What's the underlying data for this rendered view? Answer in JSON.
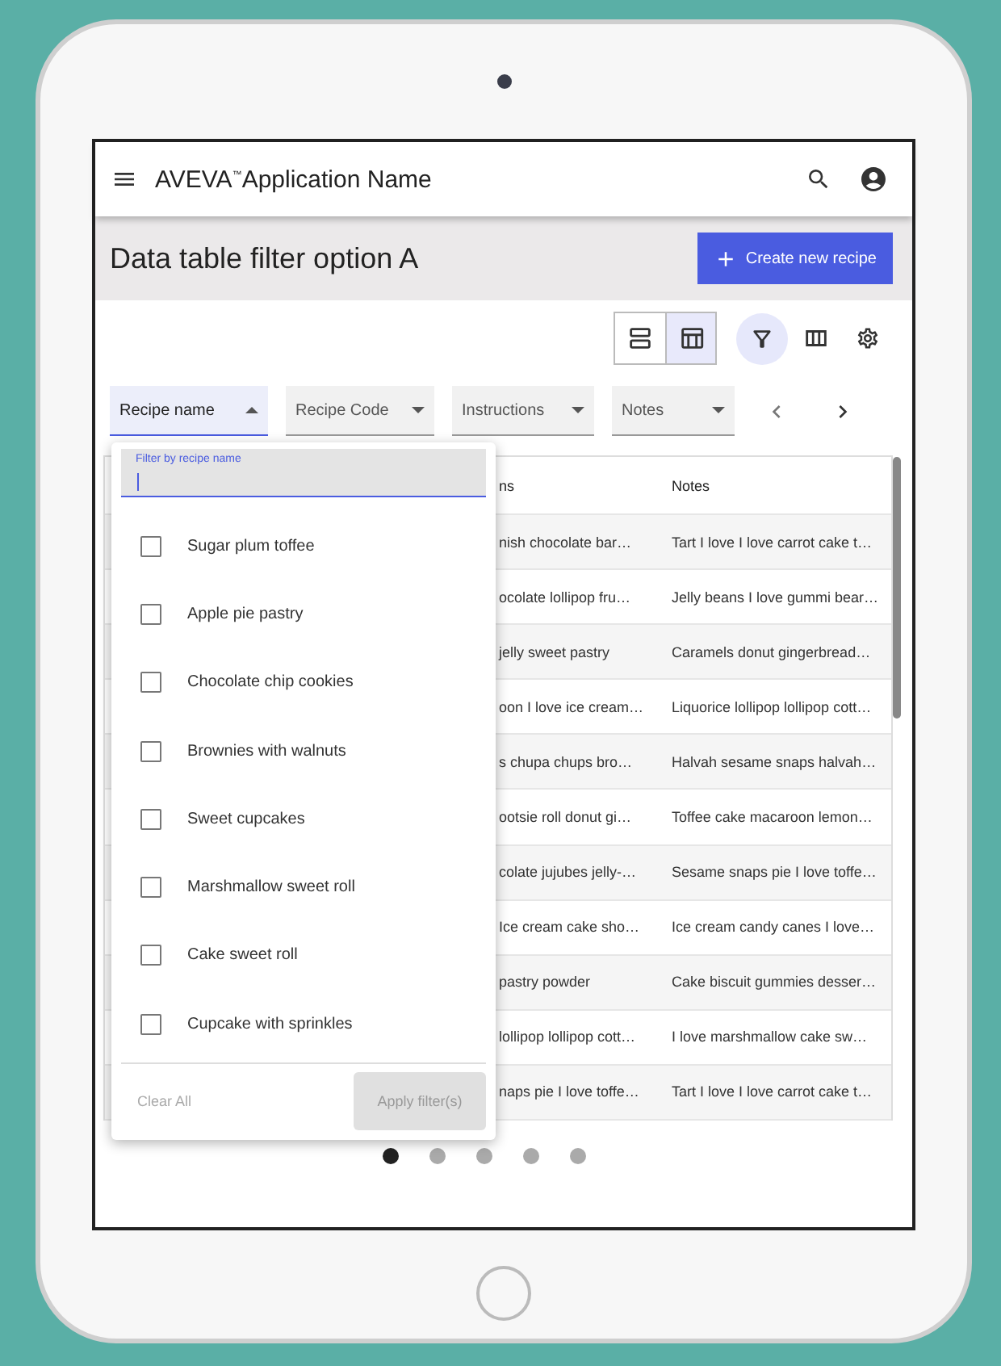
{
  "app_bar": {
    "title": "AVEVA$^{™}$Application Name"
  },
  "page_header": {
    "title": "Data table filter option A",
    "create_button": "Create new recipe"
  },
  "toolbar": {
    "view_toggles": [
      {
        "kind": "rows",
        "selected": false
      },
      {
        "kind": "table",
        "selected": true
      }
    ],
    "filter_active": true
  },
  "filter_chips": [
    {
      "label": "Recipe name",
      "selected": true
    },
    {
      "label": "Recipe Code",
      "selected": false
    },
    {
      "label": "Instructions",
      "selected": false
    },
    {
      "label": "Notes",
      "selected": false
    }
  ],
  "table": {
    "columns": [
      "ns",
      "Notes"
    ],
    "rows": [
      [
        "nish chocolate bar…",
        "Tart I love I love carrot cake t…"
      ],
      [
        "ocolate lollipop fru…",
        "Jelly beans I love gummi bear…"
      ],
      [
        "jelly sweet pastry",
        "Caramels donut gingerbread…"
      ],
      [
        "oon I love ice cream…",
        "Liquorice lollipop lollipop cott…"
      ],
      [
        "s chupa chups bro…",
        "Halvah sesame snaps halvah…"
      ],
      [
        "ootsie roll donut gi…",
        "Toffee cake macaroon lemon…"
      ],
      [
        "colate jujubes jelly-…",
        "Sesame snaps pie I love toffe…"
      ],
      [
        "Ice cream cake sho…",
        "Ice cream candy canes I love…"
      ],
      [
        "pastry powder",
        "Cake biscuit gummies desser…"
      ],
      [
        "lollipop lollipop cott…",
        "I love marshmallow cake sw…"
      ],
      [
        "naps pie I love toffe…",
        "Tart I love I love carrot cake t…"
      ]
    ]
  },
  "filter_popup": {
    "placeholder": "Filter by recipe name",
    "options": [
      {
        "label": "Sugar plum toffee",
        "checked": false
      },
      {
        "label": "Apple pie pastry",
        "checked": false
      },
      {
        "label": "Chocolate chip cookies",
        "checked": false
      },
      {
        "label": "Brownies with walnuts",
        "checked": false
      },
      {
        "label": "Sweet cupcakes",
        "checked": false
      },
      {
        "label": "Marshmallow sweet roll",
        "checked": false
      },
      {
        "label": "Cake sweet roll",
        "checked": false
      },
      {
        "label": "Cupcake with sprinkles",
        "checked": false
      }
    ],
    "clear_button": "Clear All",
    "apply_button": "Apply filter(s)"
  },
  "pagination": [
    {
      "selected": true
    },
    {
      "selected": false
    },
    {
      "selected": false
    },
    {
      "selected": false
    },
    {
      "selected": false
    }
  ]
}
